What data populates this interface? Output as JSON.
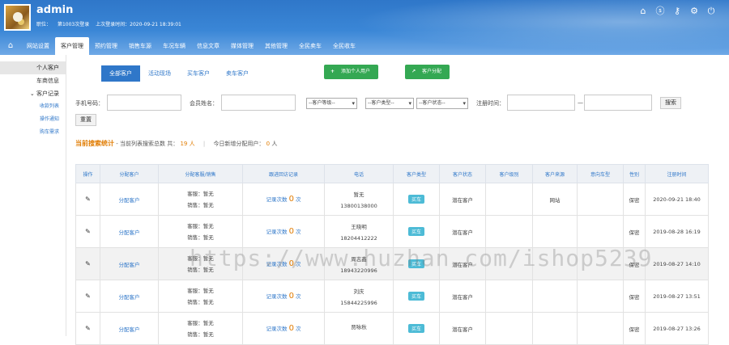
{
  "header": {
    "username": "admin",
    "role_label": "职位：",
    "login_count": "第1003次登录",
    "last_login": "上次登录时间：2020-09-21 18:39:01"
  },
  "nav": {
    "items": [
      "网站设置",
      "客户管理",
      "预约管理",
      "销售车源",
      "车况车辆",
      "信息文章",
      "媒体管理",
      "其他管理",
      "全民卖车",
      "全民收车"
    ]
  },
  "sidebar": {
    "items": [
      "个人客户",
      "车商信息",
      "客户记录",
      "收款列表",
      "操作通知",
      "购车需求"
    ]
  },
  "tabs": [
    "全部客户",
    "活动现场",
    "买车客户",
    "卖车客户"
  ],
  "buttons": {
    "add_user": "添加个人用户",
    "assign": "客户分配"
  },
  "filter": {
    "phone_label": "手机号码：",
    "name_label": "会员姓名：",
    "level_select": "--客户等级--",
    "type_select": "--客户类型--",
    "status_select": "--客户状态--",
    "time_label": "注册时间：",
    "dash": "—",
    "search_btn": "搜索",
    "reset_btn": "重置"
  },
  "stats": {
    "title": "当前搜索统计",
    "total_prefix": "- 当前列表搜索总数 共：",
    "total": "19",
    "unit": "人",
    "sep": "|",
    "today_prefix": "今日新增分配用户：",
    "today": "0",
    "today_unit": "人"
  },
  "table": {
    "headers": [
      "操作",
      "分配客户",
      "分配客服/销售",
      "跟进回访记录",
      "电话",
      "客户类型",
      "客户状态",
      "客户级别",
      "客户来源",
      "意向车型",
      "性别",
      "注册时间"
    ],
    "rows": [
      {
        "assign": "分配客户",
        "service": "客服：暂无",
        "sales": "销售：暂无",
        "rec_label": "记录次数",
        "rec_count": "0",
        "rec_unit": "次",
        "name": "暂无",
        "phone": "13800138000",
        "type": "买车",
        "status": "潜在客户",
        "level": "",
        "source": "网站",
        "model": "",
        "gender": "保密",
        "date": "2020-09-21 18:40"
      },
      {
        "assign": "分配客户",
        "service": "客服：暂无",
        "sales": "销售：暂无",
        "rec_label": "记录次数",
        "rec_count": "0",
        "rec_unit": "次",
        "name": "王晓明",
        "phone": "18204412222",
        "type": "买车",
        "status": "潜在客户",
        "level": "",
        "source": "",
        "model": "",
        "gender": "保密",
        "date": "2019-08-28 16:19"
      },
      {
        "assign": "分配客户",
        "service": "客服：暂无",
        "sales": "销售：暂无",
        "rec_label": "记录次数",
        "rec_count": "0",
        "rec_unit": "次",
        "name": "周志鑫",
        "phone": "18943220996",
        "type": "买车",
        "status": "潜在客户",
        "level": "",
        "source": "",
        "model": "",
        "gender": "保密",
        "date": "2019-08-27 14:10"
      },
      {
        "assign": "分配客户",
        "service": "客服：暂无",
        "sales": "销售：暂无",
        "rec_label": "记录次数",
        "rec_count": "0",
        "rec_unit": "次",
        "name": "刘庆",
        "phone": "15844225996",
        "type": "买车",
        "status": "潜在客户",
        "level": "",
        "source": "",
        "model": "",
        "gender": "保密",
        "date": "2019-08-27 13:51"
      },
      {
        "assign": "分配客户",
        "service": "客服：暂无",
        "sales": "销售：暂无",
        "rec_label": "记录次数",
        "rec_count": "0",
        "rec_unit": "次",
        "name": "贾咏秋",
        "phone": "",
        "type": "买车",
        "status": "潜在客户",
        "level": "",
        "source": "",
        "model": "",
        "gender": "保密",
        "date": "2019-08-27 13:26"
      }
    ]
  },
  "watermark": "https://www.huzhan.com/ishop5239",
  "colors": {
    "primary": "#2f77c9",
    "green": "#34a853",
    "orange": "#e07b00",
    "badge": "#4dbbd6"
  }
}
